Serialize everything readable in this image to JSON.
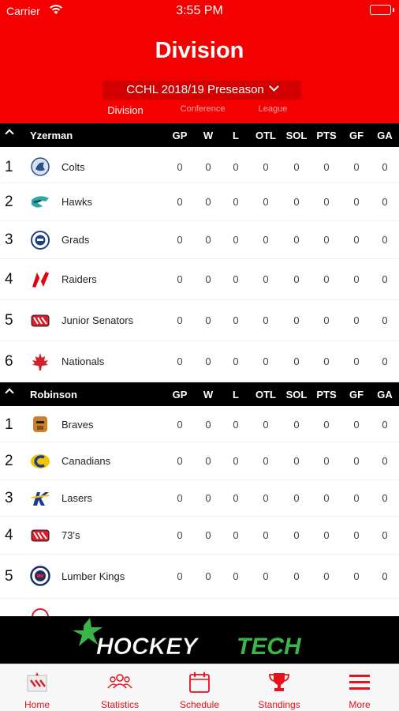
{
  "status_bar": {
    "carrier": "Carrier",
    "time": "3:55 PM"
  },
  "header": {
    "title": "Division",
    "season": "CCHL 2018/19 Preseason",
    "segments": [
      "Division",
      "Conference",
      "League"
    ]
  },
  "columns": [
    "GP",
    "W",
    "L",
    "OTL",
    "SOL",
    "PTS",
    "GF",
    "GA"
  ],
  "groups": [
    {
      "name": "Yzerman",
      "rows": [
        {
          "rank": "1",
          "team": "Colts",
          "logo": "colts-logo",
          "stats": [
            "0",
            "0",
            "0",
            "0",
            "0",
            "0",
            "0",
            "0"
          ]
        },
        {
          "rank": "2",
          "team": "Hawks",
          "logo": "hawks-logo",
          "stats": [
            "0",
            "0",
            "0",
            "0",
            "0",
            "0",
            "0",
            "0"
          ]
        },
        {
          "rank": "3",
          "team": "Grads",
          "logo": "grads-logo",
          "stats": [
            "0",
            "0",
            "0",
            "0",
            "0",
            "0",
            "0",
            "0"
          ]
        },
        {
          "rank": "4",
          "team": "Raiders",
          "logo": "raiders-logo",
          "stats": [
            "0",
            "0",
            "0",
            "0",
            "0",
            "0",
            "0",
            "0"
          ]
        },
        {
          "rank": "5",
          "team": "Junior Senators",
          "logo": "junior-senators-logo",
          "stats": [
            "0",
            "0",
            "0",
            "0",
            "0",
            "0",
            "0",
            "0"
          ]
        },
        {
          "rank": "6",
          "team": "Nationals",
          "logo": "nationals-logo",
          "stats": [
            "0",
            "0",
            "0",
            "0",
            "0",
            "0",
            "0",
            "0"
          ]
        }
      ]
    },
    {
      "name": "Robinson",
      "rows": [
        {
          "rank": "1",
          "team": "Braves",
          "logo": "braves-logo",
          "stats": [
            "0",
            "0",
            "0",
            "0",
            "0",
            "0",
            "0",
            "0"
          ]
        },
        {
          "rank": "2",
          "team": "Canadians",
          "logo": "canadians-logo",
          "stats": [
            "0",
            "0",
            "0",
            "0",
            "0",
            "0",
            "0",
            "0"
          ]
        },
        {
          "rank": "3",
          "team": "Lasers",
          "logo": "lasers-logo",
          "stats": [
            "0",
            "0",
            "0",
            "0",
            "0",
            "0",
            "0",
            "0"
          ]
        },
        {
          "rank": "4",
          "team": "73's",
          "logo": "73s-logo",
          "stats": [
            "0",
            "0",
            "0",
            "0",
            "0",
            "0",
            "0",
            "0"
          ]
        },
        {
          "rank": "5",
          "team": "Lumber Kings",
          "logo": "lumber-kings-logo",
          "stats": [
            "0",
            "0",
            "0",
            "0",
            "0",
            "0",
            "0",
            "0"
          ]
        }
      ]
    }
  ],
  "banner": {
    "brand": "HockeyTech",
    "logo": "hockeytech-logo"
  },
  "tabs": [
    {
      "label": "Home",
      "icon": "home-icon"
    },
    {
      "label": "Statistics",
      "icon": "statistics-icon"
    },
    {
      "label": "Schedule",
      "icon": "calendar-icon"
    },
    {
      "label": "Standings",
      "icon": "trophy-icon"
    },
    {
      "label": "More",
      "icon": "menu-icon"
    }
  ],
  "colors": {
    "brand_red": "#f40000",
    "tab_red": "#e8101a",
    "header_black": "#000000"
  }
}
